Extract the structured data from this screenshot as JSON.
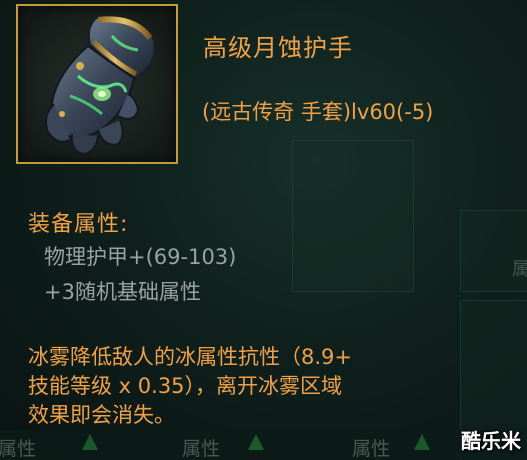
{
  "item": {
    "name": "高级月蚀护手",
    "type_line": "(远古传奇 手套)lv60(-5)",
    "icon": "gauntlet-icon"
  },
  "attributes": {
    "title": "装备属性:",
    "stats": [
      "物理护甲+(69-103)",
      "+3随机基础属性"
    ]
  },
  "description": {
    "lines": [
      "冰雾降低敌人的冰属性抗性（8.9+",
      "技能等级 x 0.35），离开冰雾区域",
      "效果即会消失。"
    ]
  },
  "background": {
    "attr_labels": [
      "属性",
      "属性",
      "属性",
      "属性"
    ],
    "side_label": "属"
  },
  "watermark": "酷乐米",
  "colors": {
    "accent_orange": "#f0a048",
    "stat_gray": "#9aa3a0",
    "frame_gold": "#c59a3a",
    "background": "#0c1614"
  }
}
